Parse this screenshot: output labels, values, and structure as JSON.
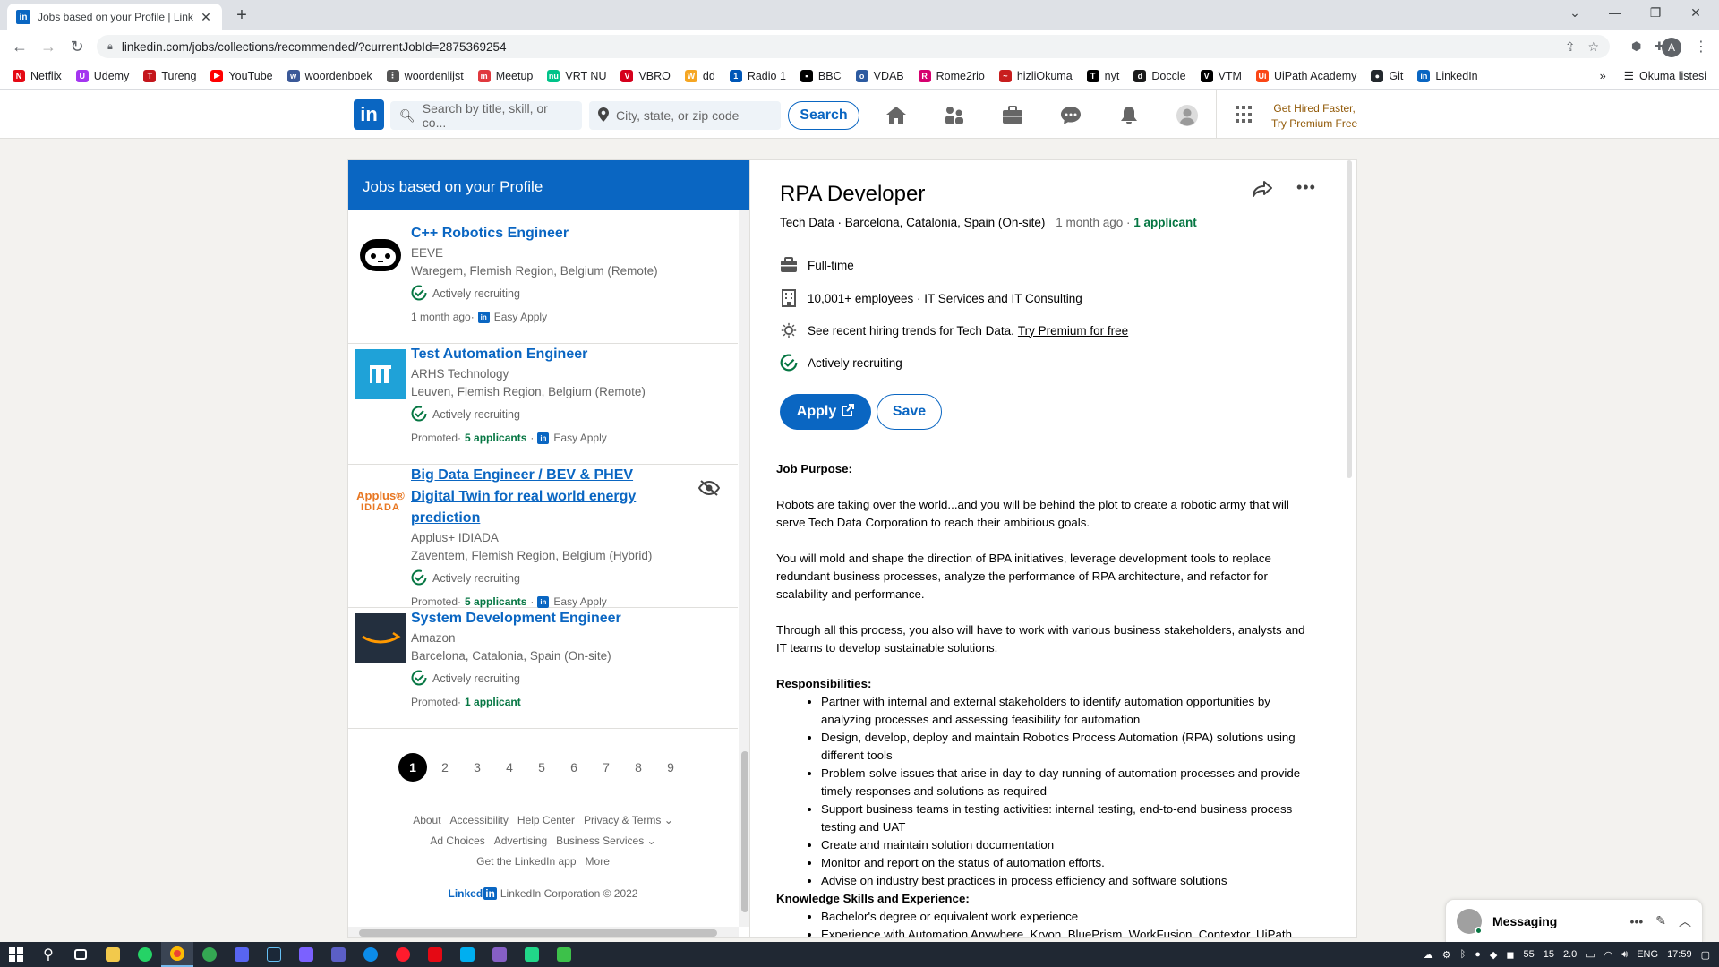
{
  "browser": {
    "tab_title": "Jobs based on your Profile | Linke",
    "tab_close": "✕",
    "new_tab": "+",
    "url": "linkedin.com/jobs/collections/recommended/?currentJobId=2875369254",
    "bookmarks": [
      {
        "label": "Netflix",
        "color": "#e50914",
        "glyph": "N"
      },
      {
        "label": "Udemy",
        "color": "#a435f0",
        "glyph": "U"
      },
      {
        "label": "Tureng",
        "color": "#c4161c",
        "glyph": "T"
      },
      {
        "label": "YouTube",
        "color": "#ff0000",
        "glyph": "▶"
      },
      {
        "label": "woordenboek",
        "color": "#3b5998",
        "glyph": "w"
      },
      {
        "label": "woordenlijst",
        "color": "#555555",
        "glyph": "⋮"
      },
      {
        "label": "Meetup",
        "color": "#e0393e",
        "glyph": "m"
      },
      {
        "label": "VRT NU",
        "color": "#00c389",
        "glyph": "nu"
      },
      {
        "label": "VBRO",
        "color": "#d5001c",
        "glyph": "V"
      },
      {
        "label": "dd",
        "color": "#f5a623",
        "glyph": "W"
      },
      {
        "label": "Radio 1",
        "color": "#0057b7",
        "glyph": "1"
      },
      {
        "label": "BBC",
        "color": "#000000",
        "glyph": "▪"
      },
      {
        "label": "VDAB",
        "color": "#2c5aa0",
        "glyph": "o"
      },
      {
        "label": "Rome2rio",
        "color": "#d6006f",
        "glyph": "R"
      },
      {
        "label": "hizliOkuma",
        "color": "#c81e1e",
        "glyph": "~"
      },
      {
        "label": "nyt",
        "color": "#000000",
        "glyph": "T"
      },
      {
        "label": "Doccle",
        "color": "#1a1a1a",
        "glyph": "d"
      },
      {
        "label": "VTM",
        "color": "#000000",
        "glyph": "V"
      },
      {
        "label": "UiPath Academy",
        "color": "#fa4616",
        "glyph": "Ui"
      },
      {
        "label": "Git",
        "color": "#24292e",
        "glyph": "●"
      },
      {
        "label": "LinkedIn",
        "color": "#0a66c2",
        "glyph": "in"
      }
    ],
    "bookmarks_overflow": "»",
    "reading_list": "Okuma listesi",
    "profile_initial": "A"
  },
  "header": {
    "logo": "in",
    "search_placeholder": "Search by title, skill, or co...",
    "location_placeholder": "City, state, or zip code",
    "search_button": "Search",
    "premium_line1": "Get Hired Faster,",
    "premium_line2": "Try Premium Free"
  },
  "left": {
    "heading": "Jobs based on your Profile",
    "jobs": [
      {
        "title": "C++ Robotics Engineer",
        "company": "EEVE",
        "location": "Waregem, Flemish Region, Belgium (Remote)",
        "recruiting": "Actively recruiting",
        "meta_prefix": "1 month ago",
        "applicants": "",
        "easy_apply": "Easy Apply"
      },
      {
        "title": "Test Automation Engineer",
        "company": "ARHS Technology",
        "location": "Leuven, Flemish Region, Belgium (Remote)",
        "recruiting": "Actively recruiting",
        "meta_prefix": "Promoted",
        "applicants": "5 applicants",
        "easy_apply": "Easy Apply"
      },
      {
        "title": "Big Data Engineer / BEV & PHEV Digital Twin for real world energy prediction",
        "company": "Applus+ IDIADA",
        "location": "Zaventem, Flemish Region, Belgium (Hybrid)",
        "recruiting": "Actively recruiting",
        "meta_prefix": "Promoted",
        "applicants": "5 applicants",
        "easy_apply": "Easy Apply",
        "logo_top": "Applus®",
        "logo_bottom": "IDIADA"
      },
      {
        "title": "System Development Engineer",
        "company": "Amazon",
        "location": "Barcelona, Catalonia, Spain (On-site)",
        "recruiting": "Actively recruiting",
        "meta_prefix": "Promoted",
        "applicants": "1 applicant",
        "easy_apply": ""
      }
    ],
    "pages": [
      "1",
      "2",
      "3",
      "4",
      "5",
      "6",
      "7",
      "8",
      "9"
    ],
    "footer": {
      "row1": [
        "About",
        "Accessibility",
        "Help Center",
        "Privacy & Terms ⌄"
      ],
      "row2": [
        "Ad Choices",
        "Advertising",
        "Business Services ⌄"
      ],
      "row3": [
        "Get the LinkedIn app",
        "More"
      ],
      "brand": "Linked",
      "brand_in": "in",
      "copyright": "LinkedIn Corporation © 2022"
    }
  },
  "detail": {
    "title": "RPA Developer",
    "company": "Tech Data",
    "location": "Barcelona, Catalonia, Spain (On-site)",
    "posted": "1 month ago",
    "applicants": "1 applicant",
    "employment": "Full-time",
    "company_size": "10,001+ employees · IT Services and IT Consulting",
    "trends_text": "See recent hiring trends for Tech Data.",
    "trends_link": "Try Premium for free",
    "recruiting": "Actively recruiting",
    "apply": "Apply",
    "save": "Save",
    "purpose_heading": "Job Purpose:",
    "p1": "Robots are taking over the world...and you will be behind the plot to create a robotic army that will serve Tech Data Corporation to reach their ambitious goals.",
    "p2": "You will mold and shape the direction of BPA initiatives, leverage development tools to replace redundant business processes, analyze the performance of RPA architecture, and refactor for scalability and performance.",
    "p3": "Through all this process, you also will have to work with various business stakeholders, analysts and IT teams to develop sustainable solutions.",
    "resp_heading": "Responsibilities:",
    "responsibilities": [
      "Partner with internal and external stakeholders to identify automation opportunities by analyzing processes and assessing feasibility for automation",
      "Design, develop, deploy and maintain Robotics Process Automation (RPA) solutions using different tools",
      "Problem-solve issues that arise in day-to-day running of automation processes and provide timely responses and solutions as required",
      "Support business teams in testing activities: internal testing, end-to-end business process testing and UAT",
      "Create and maintain solution documentation",
      "Monitor and report on the status of automation efforts.",
      "Advise on industry best practices in process efficiency and software solutions"
    ],
    "skills_heading": "Knowledge Skills and Experience:",
    "skills": [
      "Bachelor's degree or equivalent work experience",
      "Experience with Automation Anywhere, Kryon, BluePrism, WorkFusion, Contextor, UiPath."
    ]
  },
  "messaging": {
    "label": "Messaging",
    "more": "•••"
  },
  "taskbar": {
    "lang": "ENG",
    "time": "17:59",
    "tray_a": "55",
    "tray_b": "15",
    "tray_c": "2.0"
  }
}
